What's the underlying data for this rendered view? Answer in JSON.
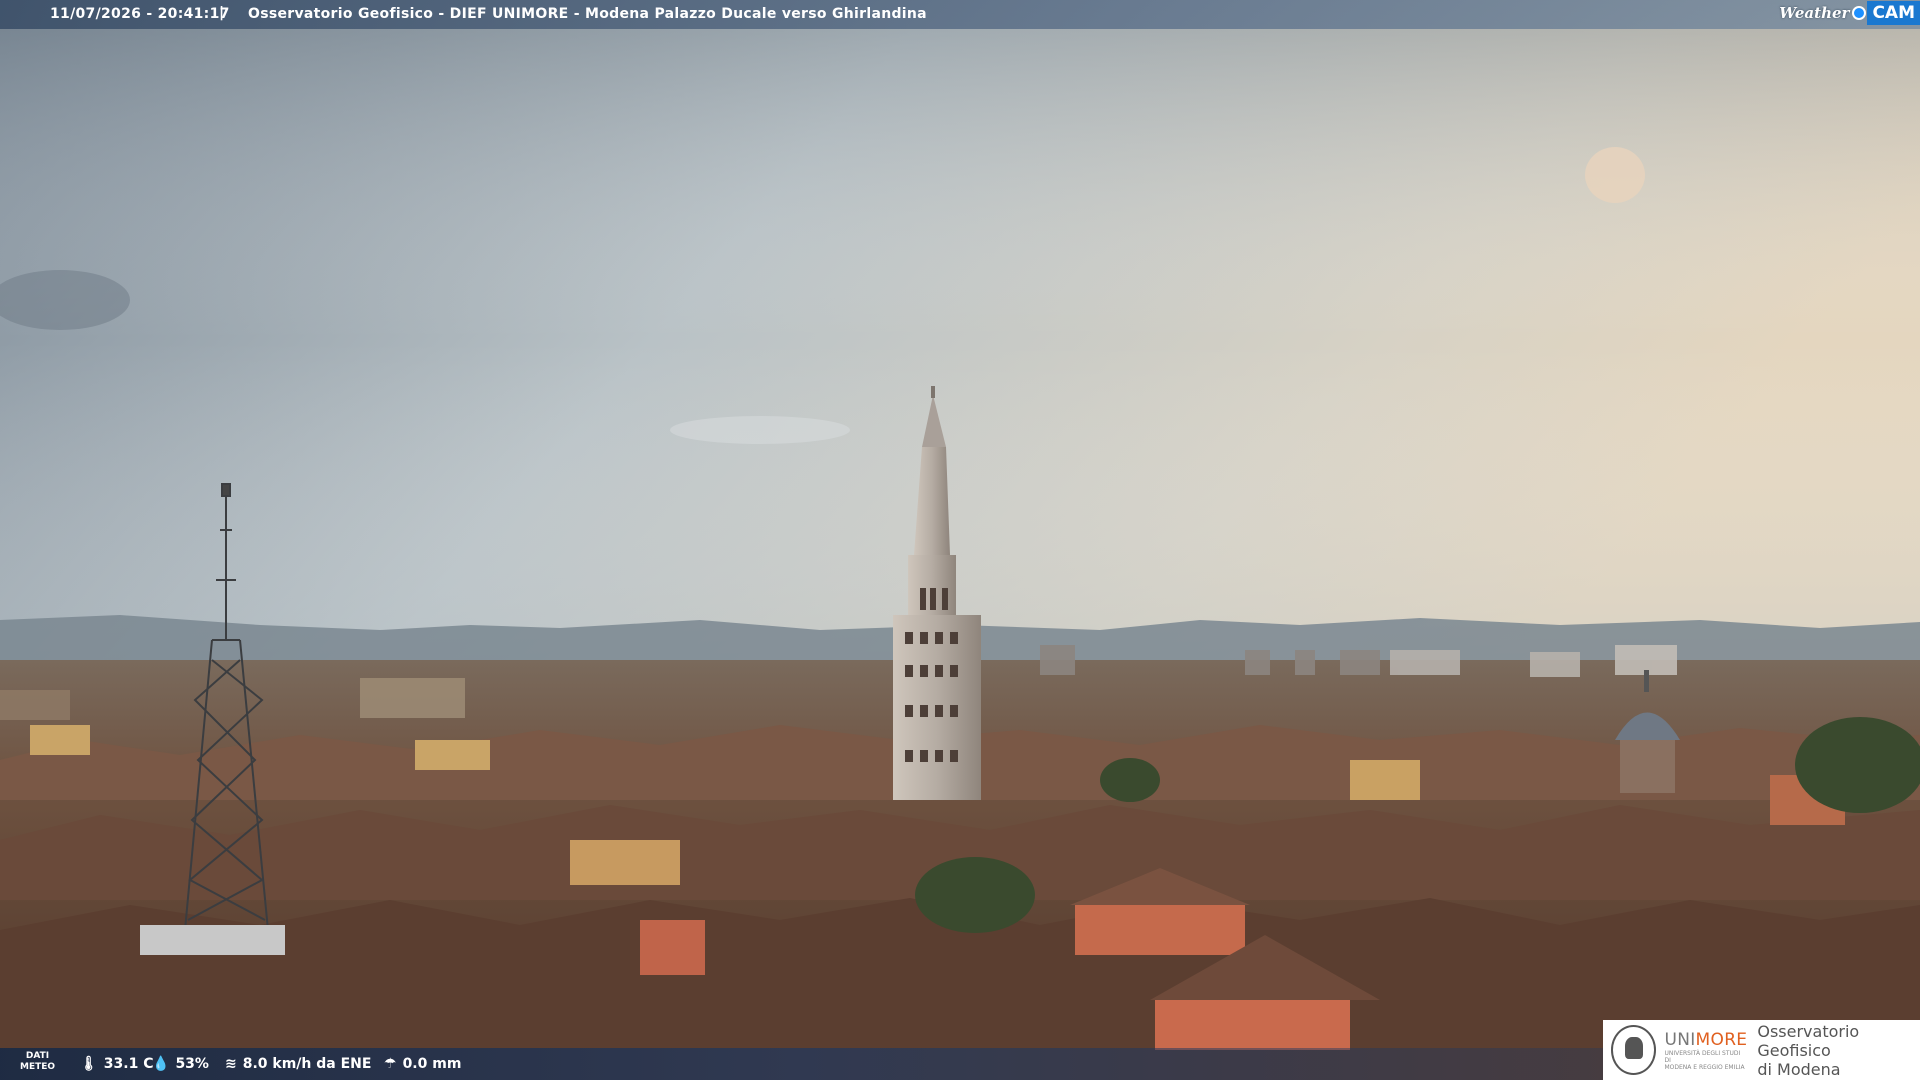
{
  "header": {
    "timestamp": "11/07/2026 - 20:41:17",
    "separator": "|",
    "location": "Osservatorio Geofisico - DIEF UNIMORE - Modena Palazzo Ducale verso Ghirlandina",
    "brand_weather": "Weather",
    "brand_cam": "CAM"
  },
  "meteo": {
    "label_line1": "DATI",
    "label_line2": "METEO",
    "temperature": "33.1 C",
    "humidity": "53%",
    "wind": "8.0 km/h da ENE",
    "rain": "0.0 mm",
    "icons": [
      "thermometer-icon",
      "humidity-drop-icon",
      "wind-icon",
      "rain-icon"
    ]
  },
  "logo": {
    "name_prefix": "UNI",
    "name_suffix": "MORE",
    "subtitle_line1": "UNIVERSITÀ DEGLI STUDI DI",
    "subtitle_line2": "MODENA E REGGIO EMILIA",
    "observatory_line1": "Osservatorio Geofisico",
    "observatory_line2": "di Modena"
  },
  "colors": {
    "accent": "#1a78d0",
    "unimore_orange": "#e06020"
  }
}
